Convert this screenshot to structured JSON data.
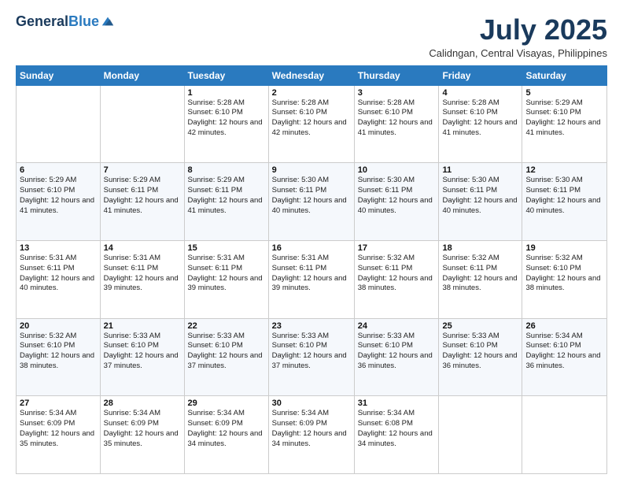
{
  "header": {
    "logo_general": "General",
    "logo_blue": "Blue",
    "month": "July 2025",
    "location": "Calidngan, Central Visayas, Philippines"
  },
  "weekdays": [
    "Sunday",
    "Monday",
    "Tuesday",
    "Wednesday",
    "Thursday",
    "Friday",
    "Saturday"
  ],
  "weeks": [
    [
      {
        "day": "",
        "info": ""
      },
      {
        "day": "",
        "info": ""
      },
      {
        "day": "1",
        "info": "Sunrise: 5:28 AM\nSunset: 6:10 PM\nDaylight: 12 hours and 42 minutes."
      },
      {
        "day": "2",
        "info": "Sunrise: 5:28 AM\nSunset: 6:10 PM\nDaylight: 12 hours and 42 minutes."
      },
      {
        "day": "3",
        "info": "Sunrise: 5:28 AM\nSunset: 6:10 PM\nDaylight: 12 hours and 41 minutes."
      },
      {
        "day": "4",
        "info": "Sunrise: 5:28 AM\nSunset: 6:10 PM\nDaylight: 12 hours and 41 minutes."
      },
      {
        "day": "5",
        "info": "Sunrise: 5:29 AM\nSunset: 6:10 PM\nDaylight: 12 hours and 41 minutes."
      }
    ],
    [
      {
        "day": "6",
        "info": "Sunrise: 5:29 AM\nSunset: 6:10 PM\nDaylight: 12 hours and 41 minutes."
      },
      {
        "day": "7",
        "info": "Sunrise: 5:29 AM\nSunset: 6:11 PM\nDaylight: 12 hours and 41 minutes."
      },
      {
        "day": "8",
        "info": "Sunrise: 5:29 AM\nSunset: 6:11 PM\nDaylight: 12 hours and 41 minutes."
      },
      {
        "day": "9",
        "info": "Sunrise: 5:30 AM\nSunset: 6:11 PM\nDaylight: 12 hours and 40 minutes."
      },
      {
        "day": "10",
        "info": "Sunrise: 5:30 AM\nSunset: 6:11 PM\nDaylight: 12 hours and 40 minutes."
      },
      {
        "day": "11",
        "info": "Sunrise: 5:30 AM\nSunset: 6:11 PM\nDaylight: 12 hours and 40 minutes."
      },
      {
        "day": "12",
        "info": "Sunrise: 5:30 AM\nSunset: 6:11 PM\nDaylight: 12 hours and 40 minutes."
      }
    ],
    [
      {
        "day": "13",
        "info": "Sunrise: 5:31 AM\nSunset: 6:11 PM\nDaylight: 12 hours and 40 minutes."
      },
      {
        "day": "14",
        "info": "Sunrise: 5:31 AM\nSunset: 6:11 PM\nDaylight: 12 hours and 39 minutes."
      },
      {
        "day": "15",
        "info": "Sunrise: 5:31 AM\nSunset: 6:11 PM\nDaylight: 12 hours and 39 minutes."
      },
      {
        "day": "16",
        "info": "Sunrise: 5:31 AM\nSunset: 6:11 PM\nDaylight: 12 hours and 39 minutes."
      },
      {
        "day": "17",
        "info": "Sunrise: 5:32 AM\nSunset: 6:11 PM\nDaylight: 12 hours and 38 minutes."
      },
      {
        "day": "18",
        "info": "Sunrise: 5:32 AM\nSunset: 6:11 PM\nDaylight: 12 hours and 38 minutes."
      },
      {
        "day": "19",
        "info": "Sunrise: 5:32 AM\nSunset: 6:10 PM\nDaylight: 12 hours and 38 minutes."
      }
    ],
    [
      {
        "day": "20",
        "info": "Sunrise: 5:32 AM\nSunset: 6:10 PM\nDaylight: 12 hours and 38 minutes."
      },
      {
        "day": "21",
        "info": "Sunrise: 5:33 AM\nSunset: 6:10 PM\nDaylight: 12 hours and 37 minutes."
      },
      {
        "day": "22",
        "info": "Sunrise: 5:33 AM\nSunset: 6:10 PM\nDaylight: 12 hours and 37 minutes."
      },
      {
        "day": "23",
        "info": "Sunrise: 5:33 AM\nSunset: 6:10 PM\nDaylight: 12 hours and 37 minutes."
      },
      {
        "day": "24",
        "info": "Sunrise: 5:33 AM\nSunset: 6:10 PM\nDaylight: 12 hours and 36 minutes."
      },
      {
        "day": "25",
        "info": "Sunrise: 5:33 AM\nSunset: 6:10 PM\nDaylight: 12 hours and 36 minutes."
      },
      {
        "day": "26",
        "info": "Sunrise: 5:34 AM\nSunset: 6:10 PM\nDaylight: 12 hours and 36 minutes."
      }
    ],
    [
      {
        "day": "27",
        "info": "Sunrise: 5:34 AM\nSunset: 6:09 PM\nDaylight: 12 hours and 35 minutes."
      },
      {
        "day": "28",
        "info": "Sunrise: 5:34 AM\nSunset: 6:09 PM\nDaylight: 12 hours and 35 minutes."
      },
      {
        "day": "29",
        "info": "Sunrise: 5:34 AM\nSunset: 6:09 PM\nDaylight: 12 hours and 34 minutes."
      },
      {
        "day": "30",
        "info": "Sunrise: 5:34 AM\nSunset: 6:09 PM\nDaylight: 12 hours and 34 minutes."
      },
      {
        "day": "31",
        "info": "Sunrise: 5:34 AM\nSunset: 6:08 PM\nDaylight: 12 hours and 34 minutes."
      },
      {
        "day": "",
        "info": ""
      },
      {
        "day": "",
        "info": ""
      }
    ]
  ]
}
